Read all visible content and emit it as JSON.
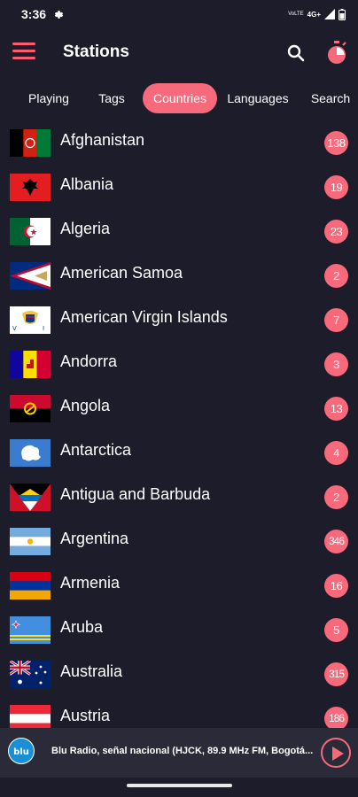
{
  "status_bar": {
    "time": "3:36",
    "net_line1": "VoLTE",
    "net_lte": "4G+"
  },
  "app_bar": {
    "title": "Stations"
  },
  "tabs": [
    {
      "label": "Playing"
    },
    {
      "label": "Tags"
    },
    {
      "label": "Countries",
      "active": true
    },
    {
      "label": "Languages"
    },
    {
      "label": "Search"
    }
  ],
  "countries": [
    {
      "name": "Afghanistan",
      "count": "138"
    },
    {
      "name": "Albania",
      "count": "19"
    },
    {
      "name": "Algeria",
      "count": "23"
    },
    {
      "name": "American Samoa",
      "count": "2"
    },
    {
      "name": "American Virgin Islands",
      "count": "7"
    },
    {
      "name": "Andorra",
      "count": "3"
    },
    {
      "name": "Angola",
      "count": "13"
    },
    {
      "name": "Antarctica",
      "count": "4"
    },
    {
      "name": "Antigua and Barbuda",
      "count": "2"
    },
    {
      "name": "Argentina",
      "count": "346"
    },
    {
      "name": "Armenia",
      "count": "16"
    },
    {
      "name": "Aruba",
      "count": "5"
    },
    {
      "name": "Australia",
      "count": "315"
    },
    {
      "name": "Austria",
      "count": "186"
    }
  ],
  "player": {
    "logo_text": "blu",
    "now_playing": "Blu Radio, señal nacional (HJCK, 89.9 MHz FM, Bogotá..."
  },
  "colors": {
    "accent": "#f66a7c",
    "background": "#1c1c2a",
    "player_bg": "#2a2a38"
  }
}
